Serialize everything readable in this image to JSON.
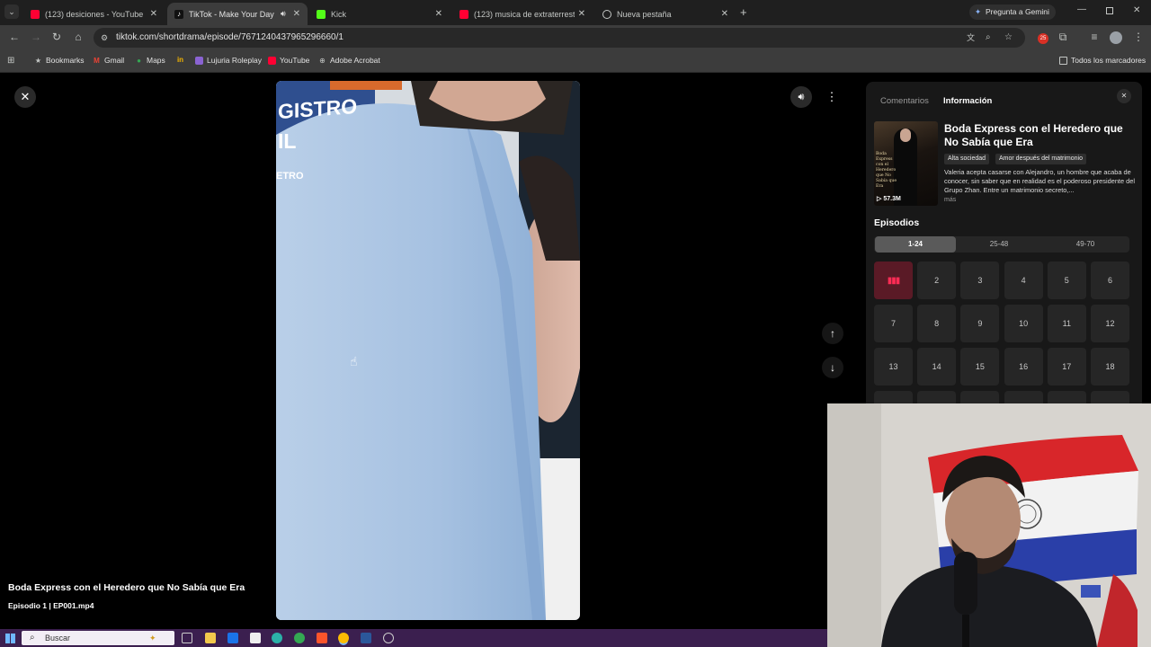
{
  "browser": {
    "tabs": [
      {
        "title": "(123) desiciones - YouTube",
        "favicon": "youtube-icon",
        "color": "#ff0033"
      },
      {
        "title": "TikTok - Make Your Day",
        "favicon": "tiktok-icon",
        "color": "#ffffff",
        "active": true
      },
      {
        "title": "Kick",
        "favicon": "kick-icon",
        "color": "#53fc18"
      },
      {
        "title": "(123) musica de extraterrestre",
        "favicon": "youtube-icon",
        "color": "#ff0033"
      },
      {
        "title": "Nueva pestaña",
        "favicon": "chrome-icon",
        "color": "#c4c7c5"
      }
    ],
    "gemini_button": "Pregunta a Gemini",
    "url": "tiktok.com/shortdrama/episode/7671240437965296660/1",
    "extension_badge": "25",
    "bookmarks": [
      {
        "label": "Bookmarks",
        "icon": "star-icon"
      },
      {
        "label": "Gmail",
        "icon": "gmail-icon"
      },
      {
        "label": "Maps",
        "icon": "maps-icon"
      },
      {
        "label": "",
        "icon": "in-icon"
      },
      {
        "label": "Lujuria Roleplay",
        "icon": "link-icon"
      },
      {
        "label": "YouTube",
        "icon": "youtube-icon"
      },
      {
        "label": "Adobe Acrobat",
        "icon": "acrobat-icon"
      }
    ],
    "all_bookmarks": "Todos los marcadores"
  },
  "player": {
    "title": "Boda Express con el Heredero que No Sabía que Era",
    "episode_line": "Episodio 1 | EP001.mp4",
    "sign_text_1": "GISTRO",
    "sign_text_2": "IL",
    "sign_text_3": "ETRO"
  },
  "panel": {
    "tabs": [
      "Comentarios",
      "Información"
    ],
    "active_tab": "Información",
    "drama_title": "Boda Express con el Heredero que No Sabía que Era",
    "tags": [
      "Alta sociedad",
      "Amor después del matrimonio"
    ],
    "description": "Valeria acepta casarse con Alejandro, un hombre que acaba de conocer, sin saber que en realidad es el poderoso presidente del Grupo Zhan. Entre un matrimonio secreto,...",
    "more": "más",
    "views": "57.3M",
    "poster_text": "Boda Express con el Heredero que No Sabía que Era",
    "episodes_header": "Episodios",
    "ranges": [
      "1-24",
      "25-48",
      "49-70"
    ],
    "active_range": "1-24",
    "episodes": [
      "1",
      "2",
      "3",
      "4",
      "5",
      "6",
      "7",
      "8",
      "9",
      "10",
      "11",
      "12",
      "13",
      "14",
      "15",
      "16",
      "17",
      "18"
    ],
    "current_episode": "1"
  },
  "taskbar": {
    "search_placeholder": "Buscar"
  }
}
